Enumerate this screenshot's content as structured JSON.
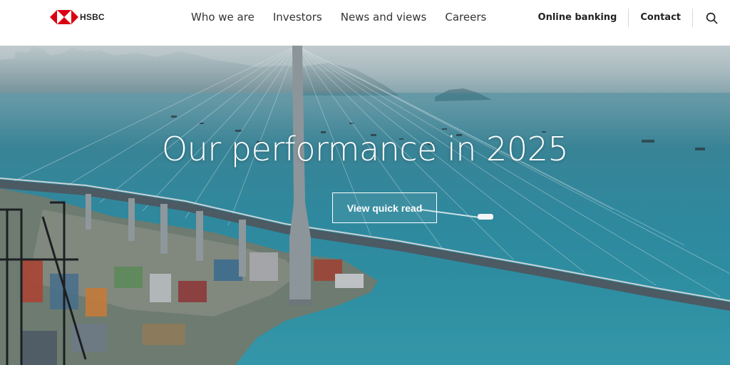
{
  "brand": {
    "name": "HSBC",
    "logo_color": "#db0011"
  },
  "nav": {
    "items": [
      {
        "label": "Who we are"
      },
      {
        "label": "Investors"
      },
      {
        "label": "News and views"
      },
      {
        "label": "Careers"
      }
    ]
  },
  "utility": {
    "online_banking": "Online banking",
    "contact": "Contact",
    "search_icon": "search-icon"
  },
  "hero": {
    "title": "Our performance in 2025",
    "cta_label": "View quick read",
    "image": "aerial-harbour-bridge-container-port"
  }
}
